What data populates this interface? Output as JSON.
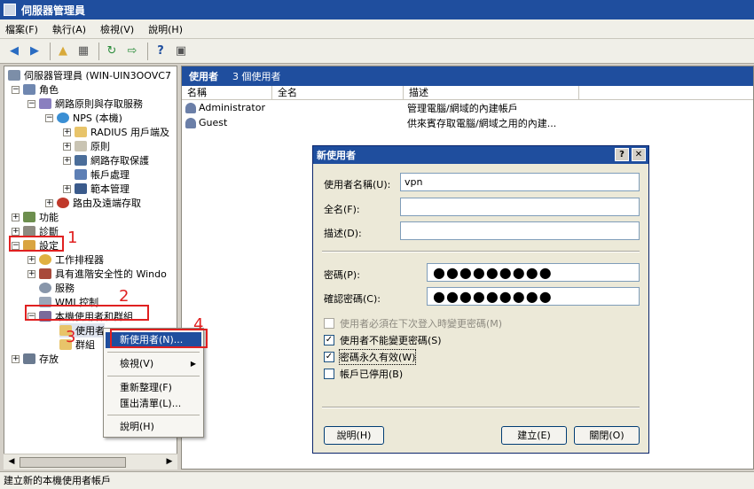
{
  "window": {
    "title": "伺服器管理員"
  },
  "menu": [
    "檔案(F)",
    "執行(A)",
    "檢視(V)",
    "說明(H)"
  ],
  "toolbar_icons": [
    "back-arrow-icon",
    "forward-arrow-icon",
    "up-folder-icon",
    "show-tree-icon",
    "refresh-icon",
    "export-list-icon",
    "help-icon",
    "properties-icon"
  ],
  "tree": {
    "root": "伺服器管理員 (WIN-UIN3OOVC7",
    "items": [
      {
        "label": "角色"
      },
      {
        "label": "網路原則與存取服務"
      },
      {
        "label": "NPS (本機)"
      },
      {
        "label": "RADIUS 用戶端及"
      },
      {
        "label": "原則"
      },
      {
        "label": "網路存取保護"
      },
      {
        "label": "帳戶處理"
      },
      {
        "label": "範本管理"
      },
      {
        "label": "路由及遠端存取"
      },
      {
        "label": "功能"
      },
      {
        "label": "診斷"
      },
      {
        "label": "設定"
      },
      {
        "label": "工作排程器"
      },
      {
        "label": "具有進階安全性的 Windo"
      },
      {
        "label": "服務"
      },
      {
        "label": "WMI 控制"
      },
      {
        "label": "本機使用者和群組"
      },
      {
        "label": "使用者"
      },
      {
        "label": "群組"
      },
      {
        "label": "存放"
      }
    ]
  },
  "right": {
    "header": "使用者",
    "count": "3 個使用者",
    "columns": [
      "名稱",
      "全名",
      "描述"
    ],
    "rows": [
      {
        "name": "Administrator",
        "fullname": "",
        "desc": "管理電腦/網域的內建帳戶"
      },
      {
        "name": "Guest",
        "fullname": "",
        "desc": "供來賓存取電腦/網域之用的內建..."
      }
    ]
  },
  "context_menu": {
    "new_user": "新使用者(N)...",
    "view": "檢視(V)",
    "refresh": "重新整理(F)",
    "export": "匯出清單(L)...",
    "help": "說明(H)"
  },
  "annotations": [
    "1",
    "2",
    "3",
    "4"
  ],
  "dialog": {
    "title": "新使用者",
    "help_btn": "?",
    "close_btn": "✕",
    "username_label": "使用者名稱(U):",
    "username_value": "vpn",
    "fullname_label": "全名(F):",
    "fullname_value": "",
    "desc_label": "描述(D):",
    "desc_value": "",
    "password_label": "密碼(P):",
    "password_value": "●●●●●●●●●",
    "confirm_label": "確認密碼(C):",
    "confirm_value": "●●●●●●●●●",
    "options": [
      {
        "label": "使用者必須在下次登入時變更密碼(M)",
        "checked": false,
        "disabled": true
      },
      {
        "label": "使用者不能變更密碼(S)",
        "checked": true,
        "disabled": false
      },
      {
        "label": "密碼永久有效(W)",
        "checked": true,
        "disabled": false
      },
      {
        "label": "帳戶已停用(B)",
        "checked": false,
        "disabled": false
      }
    ],
    "help": "說明(H)",
    "create": "建立(E)",
    "close": "關閉(O)"
  },
  "status": "建立新的本機使用者帳戶",
  "colors": {
    "accent": "#1f4e9e",
    "annotation": "#e02020"
  }
}
